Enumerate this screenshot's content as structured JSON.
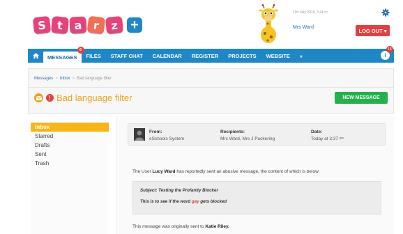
{
  "brand": {
    "letters": [
      {
        "char": "S",
        "color": "#e6437b"
      },
      {
        "char": "t",
        "color": "#e6437b"
      },
      {
        "char": "a",
        "color": "#e6437b"
      },
      {
        "char": "r",
        "color": "#f06f55"
      },
      {
        "char": "z",
        "color": "#e6437b"
      }
    ],
    "plus": "+"
  },
  "user": {
    "date": "19ᵗʰ July 2018, 3:41 ᵖᵐ",
    "name": "Mrs Ward",
    "logout_label": "LOG OUT ▾"
  },
  "nav": {
    "items": [
      "MESSAGES",
      "FILES",
      "STAFF CHAT",
      "CALENDAR",
      "REGISTER",
      "PROJECTS",
      "WEBSITE",
      "»"
    ],
    "messages_badge": "6",
    "info_badge": "15",
    "info_label": "i"
  },
  "breadcrumb": [
    "Messages",
    "Inbox",
    "Bad language filter"
  ],
  "page": {
    "title": "Bad language filter",
    "new_message_label": "NEW MESSAGE"
  },
  "sidebar": {
    "items": [
      "Inbox",
      "Starred",
      "Drafts",
      "Sent",
      "Trash"
    ],
    "active": "Inbox"
  },
  "message": {
    "from_label": "From:",
    "from_value": "eSchools System",
    "recipients_label": "Recipients:",
    "recipients_value": "Mrs Ward, Mrs J Puckering",
    "date_label": "Date:",
    "date_value": "Today at 3:37 ᵖᵐ",
    "body_pre": "The User ",
    "body_user": "Lucy Ward",
    "body_post": " has reportedly sent an abusive message, the content of which is below:",
    "quote_subject": "Subject: Testing the Profanity Blocker",
    "quote_pre": "This is to see if the word ",
    "quote_word": "gay",
    "quote_post": " gets blocked",
    "footer_pre": "This message was originally sent to ",
    "footer_name": "Katie Riley."
  },
  "colors": {
    "primary_blue": "#1e88c7",
    "accent_orange": "#f0a020",
    "danger_red": "#e24040",
    "success_green": "#23b14d",
    "sidebar_active": "#f7b51a"
  }
}
